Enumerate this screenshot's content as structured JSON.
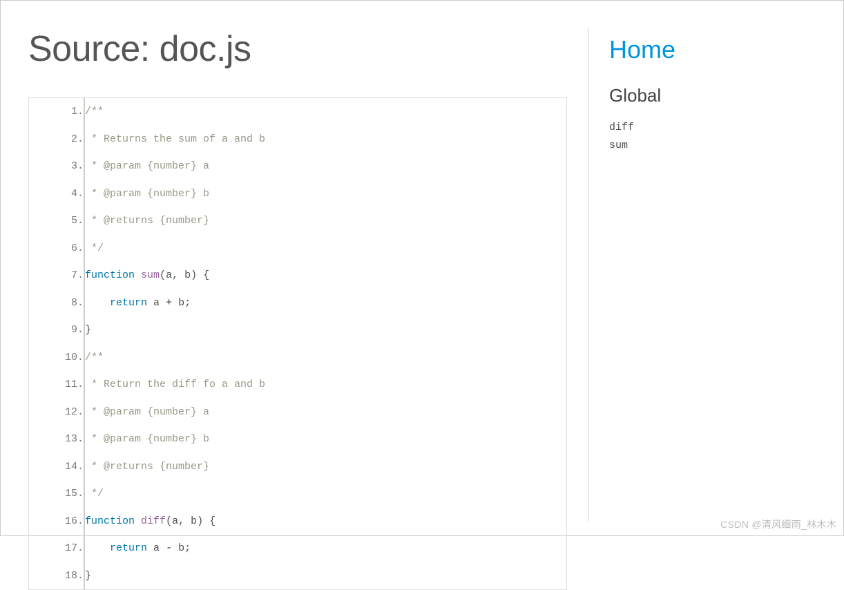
{
  "title": "Source: doc.js",
  "code": {
    "lines": [
      {
        "n": "1.",
        "tokens": [
          {
            "t": "/**",
            "c": "tok-comment"
          }
        ]
      },
      {
        "n": "2.",
        "tokens": [
          {
            "t": " * Returns the sum of a and b",
            "c": "tok-comment"
          }
        ]
      },
      {
        "n": "3.",
        "tokens": [
          {
            "t": " * @param {number} a",
            "c": "tok-comment"
          }
        ]
      },
      {
        "n": "4.",
        "tokens": [
          {
            "t": " * @param {number} b",
            "c": "tok-comment"
          }
        ]
      },
      {
        "n": "5.",
        "tokens": [
          {
            "t": " * @returns {number}",
            "c": "tok-comment"
          }
        ]
      },
      {
        "n": "6.",
        "tokens": [
          {
            "t": " */",
            "c": "tok-comment"
          }
        ]
      },
      {
        "n": "7.",
        "tokens": [
          {
            "t": "function",
            "c": "tok-keyword"
          },
          {
            "t": " ",
            "c": ""
          },
          {
            "t": "sum",
            "c": "tok-func"
          },
          {
            "t": "(",
            "c": "tok-punct"
          },
          {
            "t": "a",
            "c": "tok-ident"
          },
          {
            "t": ",",
            "c": "tok-punct"
          },
          {
            "t": " ",
            "c": ""
          },
          {
            "t": "b",
            "c": "tok-ident"
          },
          {
            "t": ")",
            "c": "tok-punct"
          },
          {
            "t": " ",
            "c": ""
          },
          {
            "t": "{",
            "c": "tok-punct"
          }
        ]
      },
      {
        "n": "8.",
        "tokens": [
          {
            "t": "    ",
            "c": ""
          },
          {
            "t": "return",
            "c": "tok-keyword"
          },
          {
            "t": " ",
            "c": ""
          },
          {
            "t": "a",
            "c": "tok-ident"
          },
          {
            "t": " ",
            "c": ""
          },
          {
            "t": "+",
            "c": "tok-op"
          },
          {
            "t": " ",
            "c": ""
          },
          {
            "t": "b",
            "c": "tok-ident"
          },
          {
            "t": ";",
            "c": "tok-punct"
          }
        ]
      },
      {
        "n": "9.",
        "tokens": [
          {
            "t": "}",
            "c": "tok-punct"
          }
        ]
      },
      {
        "n": "10.",
        "tokens": [
          {
            "t": "/**",
            "c": "tok-comment"
          }
        ]
      },
      {
        "n": "11.",
        "tokens": [
          {
            "t": " * Return the diff fo a and b",
            "c": "tok-comment"
          }
        ]
      },
      {
        "n": "12.",
        "tokens": [
          {
            "t": " * @param {number} a",
            "c": "tok-comment"
          }
        ]
      },
      {
        "n": "13.",
        "tokens": [
          {
            "t": " * @param {number} b",
            "c": "tok-comment"
          }
        ]
      },
      {
        "n": "14.",
        "tokens": [
          {
            "t": " * @returns {number}",
            "c": "tok-comment"
          }
        ]
      },
      {
        "n": "15.",
        "tokens": [
          {
            "t": " */",
            "c": "tok-comment"
          }
        ]
      },
      {
        "n": "16.",
        "tokens": [
          {
            "t": "function",
            "c": "tok-keyword"
          },
          {
            "t": " ",
            "c": ""
          },
          {
            "t": "diff",
            "c": "tok-func"
          },
          {
            "t": "(",
            "c": "tok-punct"
          },
          {
            "t": "a",
            "c": "tok-ident"
          },
          {
            "t": ",",
            "c": "tok-punct"
          },
          {
            "t": " ",
            "c": ""
          },
          {
            "t": "b",
            "c": "tok-ident"
          },
          {
            "t": ")",
            "c": "tok-punct"
          },
          {
            "t": " ",
            "c": ""
          },
          {
            "t": "{",
            "c": "tok-punct"
          }
        ]
      },
      {
        "n": "17.",
        "tokens": [
          {
            "t": "    ",
            "c": ""
          },
          {
            "t": "return",
            "c": "tok-keyword"
          },
          {
            "t": " ",
            "c": ""
          },
          {
            "t": "a",
            "c": "tok-ident"
          },
          {
            "t": " ",
            "c": ""
          },
          {
            "t": "-",
            "c": "tok-op"
          },
          {
            "t": " ",
            "c": ""
          },
          {
            "t": "b",
            "c": "tok-ident"
          },
          {
            "t": ";",
            "c": "tok-punct"
          }
        ]
      },
      {
        "n": "18.",
        "tokens": [
          {
            "t": "}",
            "c": "tok-punct"
          }
        ]
      }
    ]
  },
  "sidebar": {
    "home_label": "Home",
    "heading": "Global",
    "items": [
      {
        "label": "diff"
      },
      {
        "label": "sum"
      }
    ]
  },
  "watermark": "CSDN @清风细雨_林木木"
}
